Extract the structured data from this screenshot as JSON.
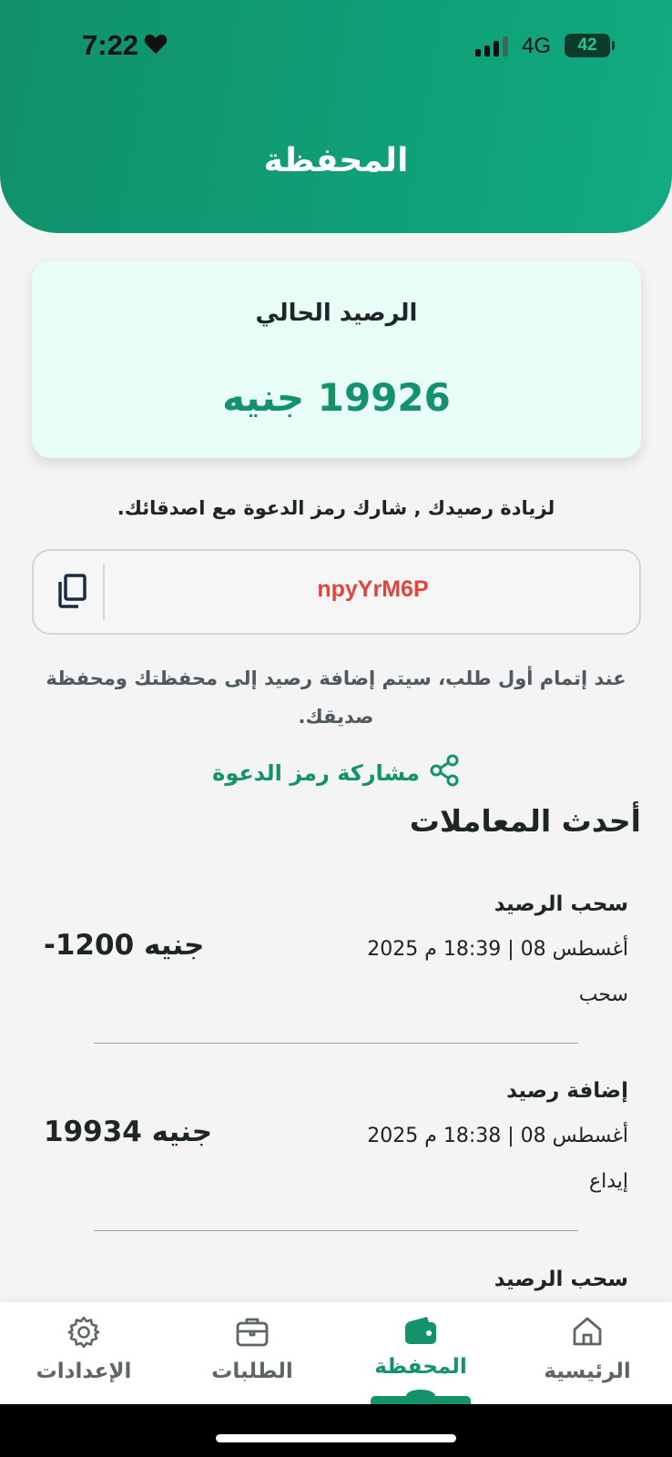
{
  "status_bar": {
    "time": "7:22",
    "network": "4G",
    "battery": "42"
  },
  "header": {
    "title": "المحفظة"
  },
  "balance": {
    "label": "الرصيد الحالي",
    "value": "19926 جنيه"
  },
  "invite": {
    "hint": "لزيادة رصيدك , شارك رمز الدعوة مع اصدقائك.",
    "code": "npyYrM6P",
    "note": "عند إتمام أول طلب، سيتم إضافة رصيد إلى محفظتك ومحفظة صديقك.",
    "share_label": "مشاركة رمز الدعوة"
  },
  "transactions": {
    "title": "أحدث المعاملات",
    "items": [
      {
        "title": "سحب الرصيد",
        "date": "2025 أغسطس 08 | 18:39 م",
        "type": "سحب",
        "amount": "-1200 جنيه"
      },
      {
        "title": "إضافة رصيد",
        "date": "2025 أغسطس 08 | 18:38 م",
        "type": "إيداع",
        "amount": "19934 جنيه"
      },
      {
        "title": "سحب الرصيد"
      }
    ]
  },
  "tabbar": {
    "tabs": [
      {
        "label": "الرئيسية",
        "icon": "home-icon"
      },
      {
        "label": "المحفظة",
        "icon": "wallet-icon",
        "active": true
      },
      {
        "label": "الطلبات",
        "icon": "briefcase-icon"
      },
      {
        "label": "الإعدادات",
        "icon": "gear-icon"
      }
    ]
  },
  "colors": {
    "primary": "#13926b",
    "code": "#e2443b",
    "card_bg": "#e8fdf7"
  }
}
